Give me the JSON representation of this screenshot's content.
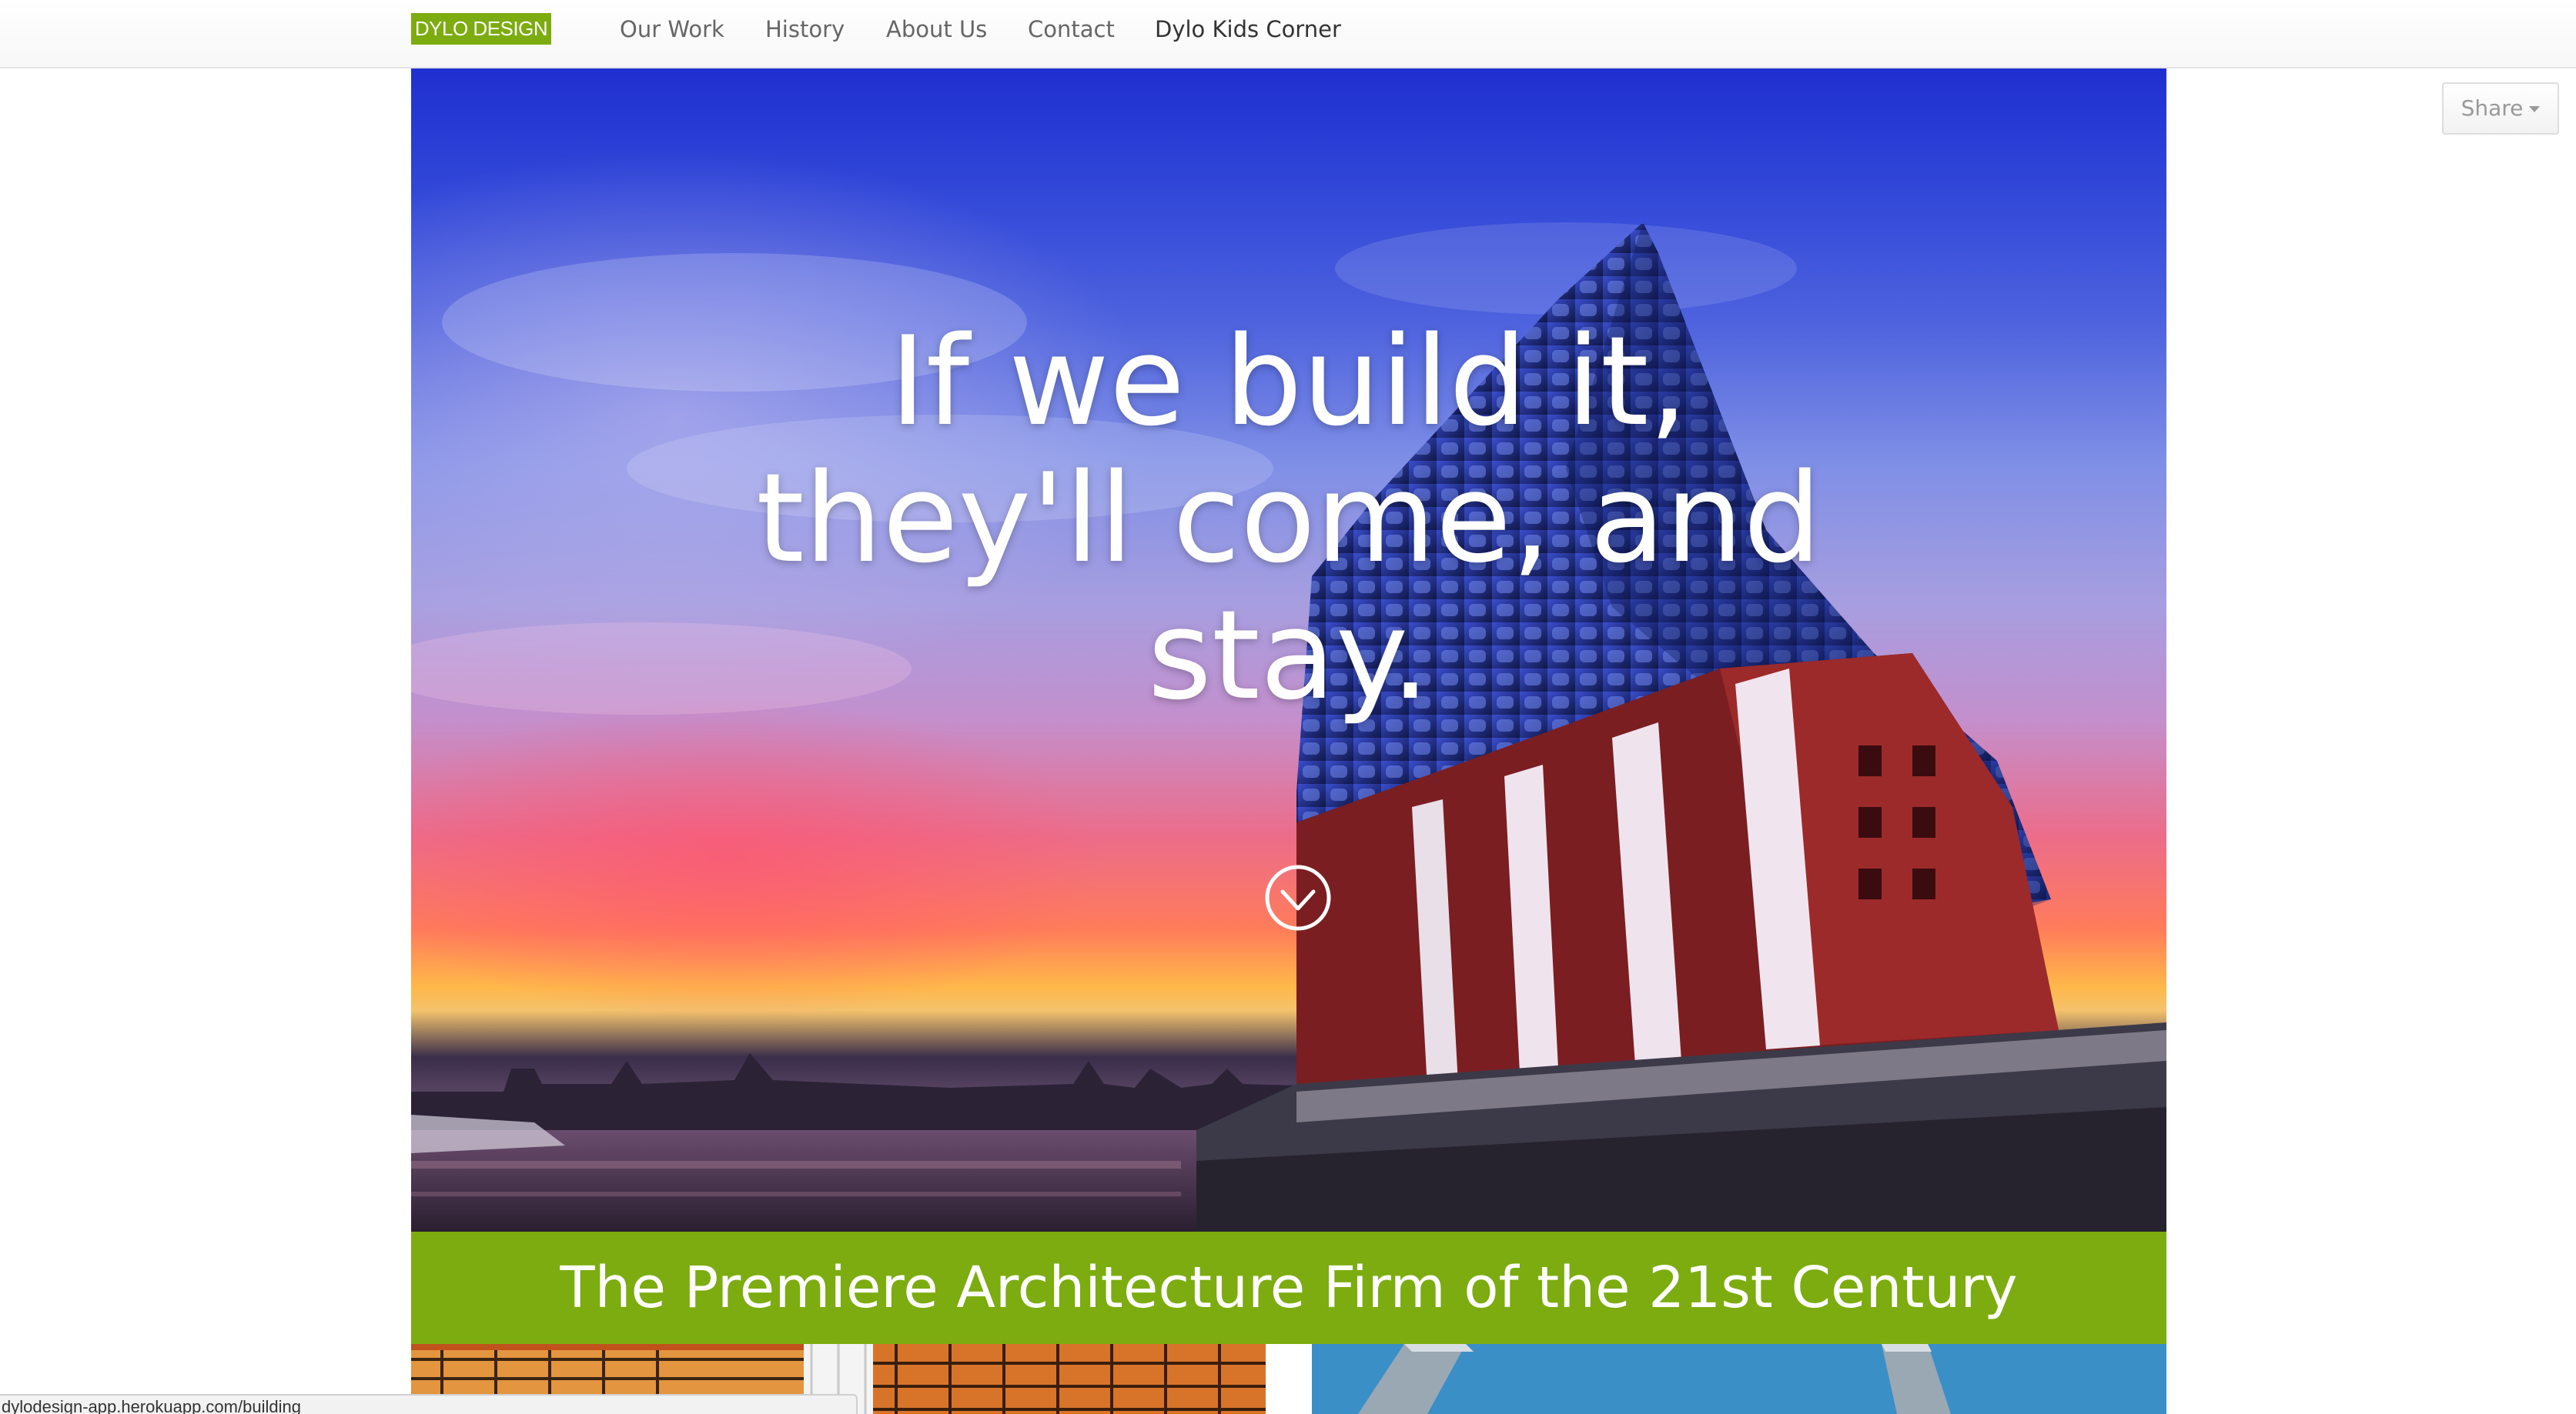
{
  "navbar": {
    "brand": "DYLO DESIGN",
    "items": [
      {
        "label": "Our Work"
      },
      {
        "label": "History"
      },
      {
        "label": "About Us"
      },
      {
        "label": "Contact"
      },
      {
        "label": "Dylo Kids Corner"
      }
    ]
  },
  "hero": {
    "headline_lines": [
      "If we build it,",
      "they'll come, and",
      "stay."
    ],
    "scroll_icon": "chevron-circle-down-icon"
  },
  "tagline": "The Premiere Architecture Firm of the 21st Century",
  "share": {
    "label": "Share",
    "icon": "caret-down-icon"
  },
  "status_bar": {
    "url": "dylodesign-app.herokuapp.com/building"
  },
  "colors": {
    "accent_green": "#7cac0f",
    "nav_text": "#666666",
    "nav_text_active": "#333333"
  }
}
